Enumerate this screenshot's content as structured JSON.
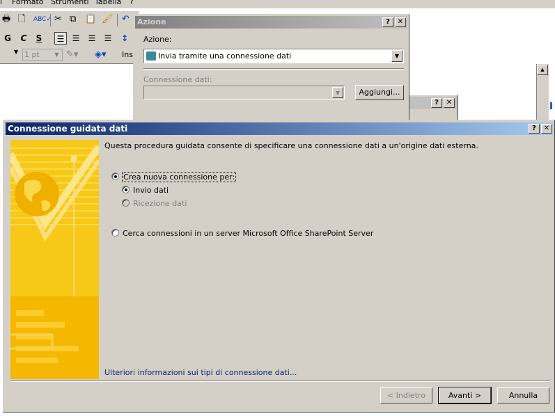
{
  "app": {
    "menu": [
      "Formato",
      "Strumenti",
      "Tabella"
    ],
    "menu_partial_left": "l",
    "menu_partial_right": "?",
    "font_size": "1 pt",
    "insert_label": "Ins"
  },
  "azione_dialog": {
    "title": "Azione",
    "help": "?",
    "close": "✕",
    "action_label": "Azione:",
    "action_value": "Invia tramite una connessione dati",
    "connection_label": "Connessione dati:",
    "connection_value": "",
    "add_button": "Aggiungi..."
  },
  "third_dialog": {
    "help": "?",
    "close": "✕"
  },
  "wizard": {
    "title": "Connessione guidata dati",
    "help": "?",
    "close": "✕",
    "intro": "Questa procedura guidata consente di specificare una connessione dati a un'origine dati esterna.",
    "options": {
      "create_new": "Crea nuova connessione per:",
      "send": "Invio dati",
      "receive": "Ricezione dati",
      "search": "Cerca connessioni in un server Microsoft Office SharePoint Server"
    },
    "more_info": "Ulteriori informazioni sui tipi di connessione dati...",
    "back": "< Indietro",
    "next": "Avanti >",
    "cancel": "Annulla"
  },
  "colors": {
    "title_active": "#0a246a",
    "title_inactive": "#808080",
    "dialog_bg": "#d4d0c8",
    "banner": "#f5c000"
  }
}
